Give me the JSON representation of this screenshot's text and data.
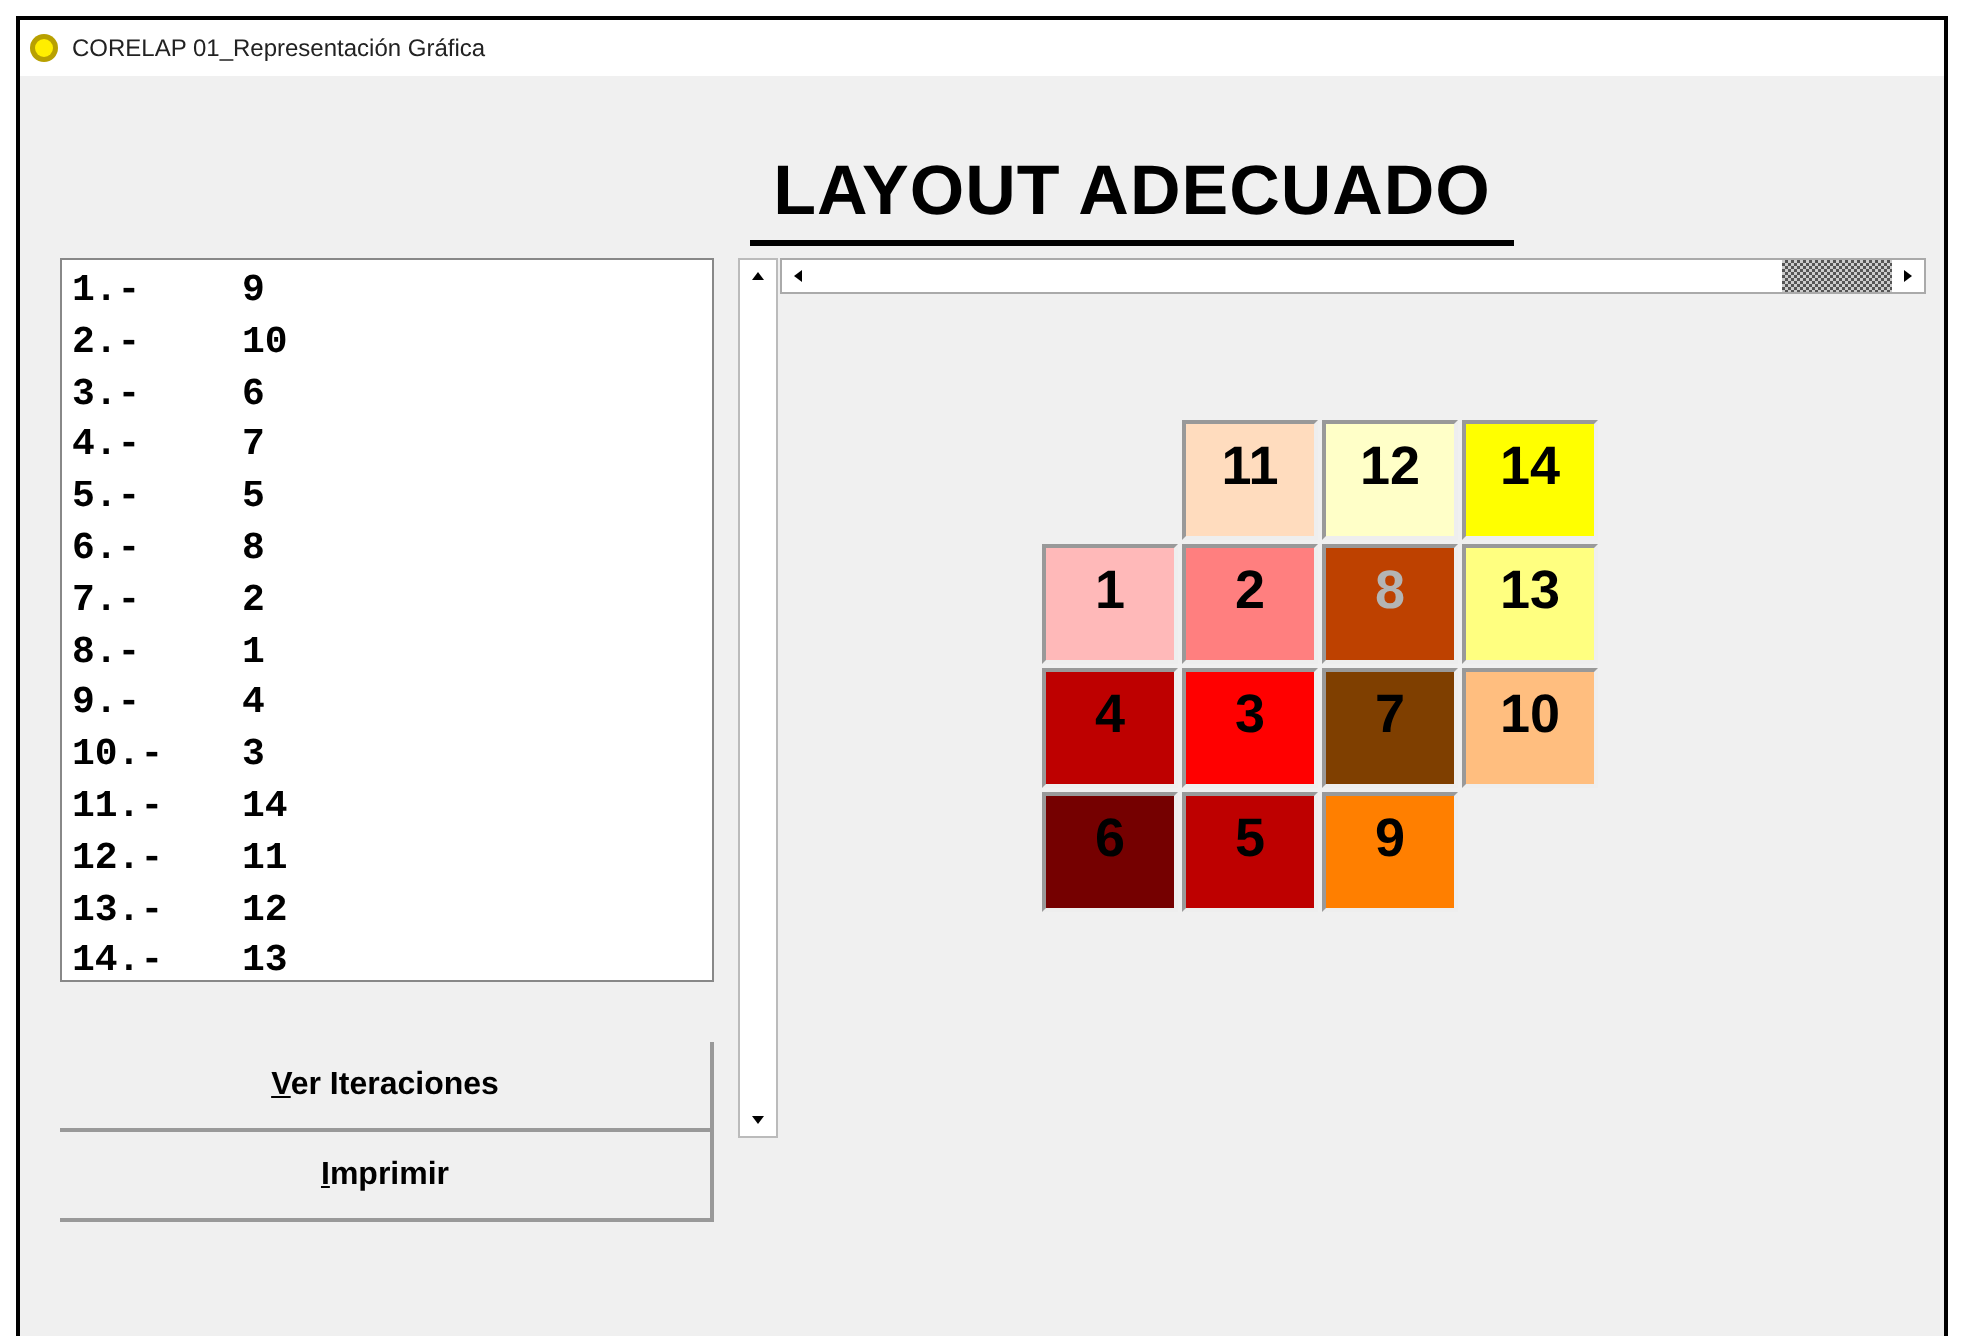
{
  "window": {
    "title": "CORELAP 01_Representación Gráfica"
  },
  "heading": "LAYOUT ADECUADO",
  "order_list": [
    {
      "rank": "1.-",
      "dept": "9"
    },
    {
      "rank": "2.-",
      "dept": "10"
    },
    {
      "rank": "3.-",
      "dept": "6"
    },
    {
      "rank": "4.-",
      "dept": "7"
    },
    {
      "rank": "5.-",
      "dept": "5"
    },
    {
      "rank": "6.-",
      "dept": "8"
    },
    {
      "rank": "7.-",
      "dept": "2"
    },
    {
      "rank": "8.-",
      "dept": "1"
    },
    {
      "rank": "9.-",
      "dept": "4"
    },
    {
      "rank": "10.-",
      "dept": "3"
    },
    {
      "rank": "11.-",
      "dept": "14"
    },
    {
      "rank": "12.-",
      "dept": "11"
    },
    {
      "rank": "13.-",
      "dept": "12"
    },
    {
      "rank": "14.-",
      "dept": "13"
    }
  ],
  "buttons": [
    {
      "mnemonic": "V",
      "rest": "er Iteraciones"
    },
    {
      "mnemonic": "I",
      "rest": "mprimir"
    }
  ],
  "layout_grid": [
    [
      {
        "kind": "empty"
      },
      {
        "kind": "block",
        "label": "11",
        "color": "#ffdcbe",
        "dimmed": false
      },
      {
        "kind": "block",
        "label": "12",
        "color": "#ffffc8",
        "dimmed": false
      },
      {
        "kind": "block",
        "label": "14",
        "color": "#ffff00",
        "dimmed": false
      }
    ],
    [
      {
        "kind": "block",
        "label": "1",
        "color": "#ffb9b9",
        "dimmed": false
      },
      {
        "kind": "block",
        "label": "2",
        "color": "#ff7f7f",
        "dimmed": false
      },
      {
        "kind": "block",
        "label": "8",
        "color": "#be4100",
        "dimmed": true
      },
      {
        "kind": "block",
        "label": "13",
        "color": "#ffff80",
        "dimmed": false
      }
    ],
    [
      {
        "kind": "block",
        "label": "4",
        "color": "#be0000",
        "dimmed": false
      },
      {
        "kind": "block",
        "label": "3",
        "color": "#ff0000",
        "dimmed": false
      },
      {
        "kind": "block",
        "label": "7",
        "color": "#7f3f00",
        "dimmed": false
      },
      {
        "kind": "block",
        "label": "10",
        "color": "#ffbe7f",
        "dimmed": false
      }
    ],
    [
      {
        "kind": "block",
        "label": "6",
        "color": "#750000",
        "dimmed": false
      },
      {
        "kind": "block",
        "label": "5",
        "color": "#be0000",
        "dimmed": false
      },
      {
        "kind": "block",
        "label": "9",
        "color": "#ff7f00",
        "dimmed": false
      },
      {
        "kind": "empty"
      }
    ]
  ]
}
